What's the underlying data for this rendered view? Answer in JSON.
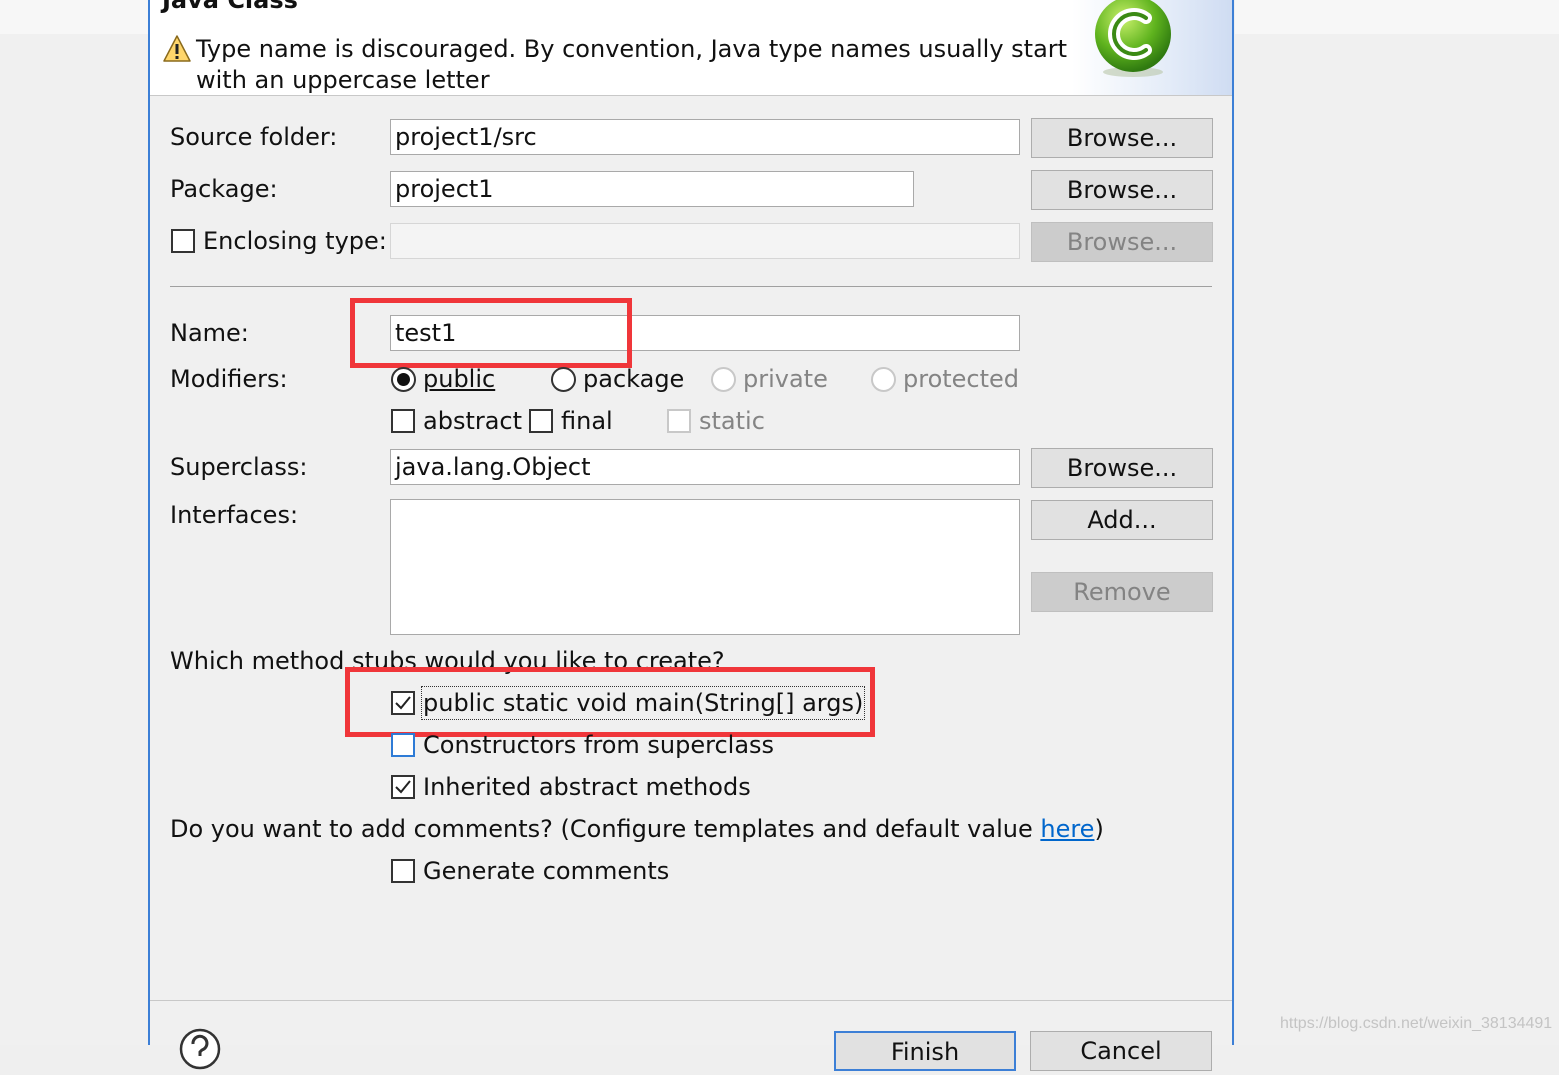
{
  "dialog": {
    "title": "Java Class",
    "message": "Type name is discouraged. By convention, Java type names usually start with an uppercase letter"
  },
  "source_folder": {
    "label": "Source folder:",
    "value": "project1/src",
    "browse": "Browse..."
  },
  "package": {
    "label": "Package:",
    "value": "project1",
    "browse": "Browse..."
  },
  "enclosing_type": {
    "label": "Enclosing type:",
    "value": "",
    "checked": false,
    "browse": "Browse..."
  },
  "name": {
    "label": "Name:",
    "value": "test1"
  },
  "modifiers": {
    "label": "Modifiers:",
    "access": [
      {
        "label": "public",
        "selected": true,
        "enabled": true
      },
      {
        "label": "package",
        "selected": false,
        "enabled": true
      },
      {
        "label": "private",
        "selected": false,
        "enabled": false
      },
      {
        "label": "protected",
        "selected": false,
        "enabled": false
      }
    ],
    "flags": [
      {
        "label": "abstract",
        "checked": false,
        "enabled": true
      },
      {
        "label": "final",
        "checked": false,
        "enabled": true
      },
      {
        "label": "static",
        "checked": false,
        "enabled": false
      }
    ]
  },
  "superclass": {
    "label": "Superclass:",
    "value": "java.lang.Object",
    "browse": "Browse..."
  },
  "interfaces": {
    "label": "Interfaces:",
    "add": "Add...",
    "remove": "Remove"
  },
  "stubs": {
    "question": "Which method stubs would you like to create?",
    "options": [
      {
        "label": "public static void main(String[] args)",
        "checked": true
      },
      {
        "label": "Constructors from superclass",
        "checked": false
      },
      {
        "label": "Inherited abstract methods",
        "checked": true
      }
    ]
  },
  "comments": {
    "question_prefix": "Do you want to add comments? (Configure templates and default value ",
    "link": "here",
    "question_suffix": ")",
    "option": {
      "label": "Generate comments",
      "checked": false
    }
  },
  "footer": {
    "finish": "Finish",
    "cancel": "Cancel"
  },
  "watermark": "https://blog.csdn.net/weixin_38134491",
  "colors": {
    "highlight": "#f0363a",
    "accent": "#3c7fd6",
    "link": "#0066cc"
  },
  "icons": {
    "warning": "warning-icon",
    "class": "new-class-icon",
    "help": "help-icon"
  }
}
